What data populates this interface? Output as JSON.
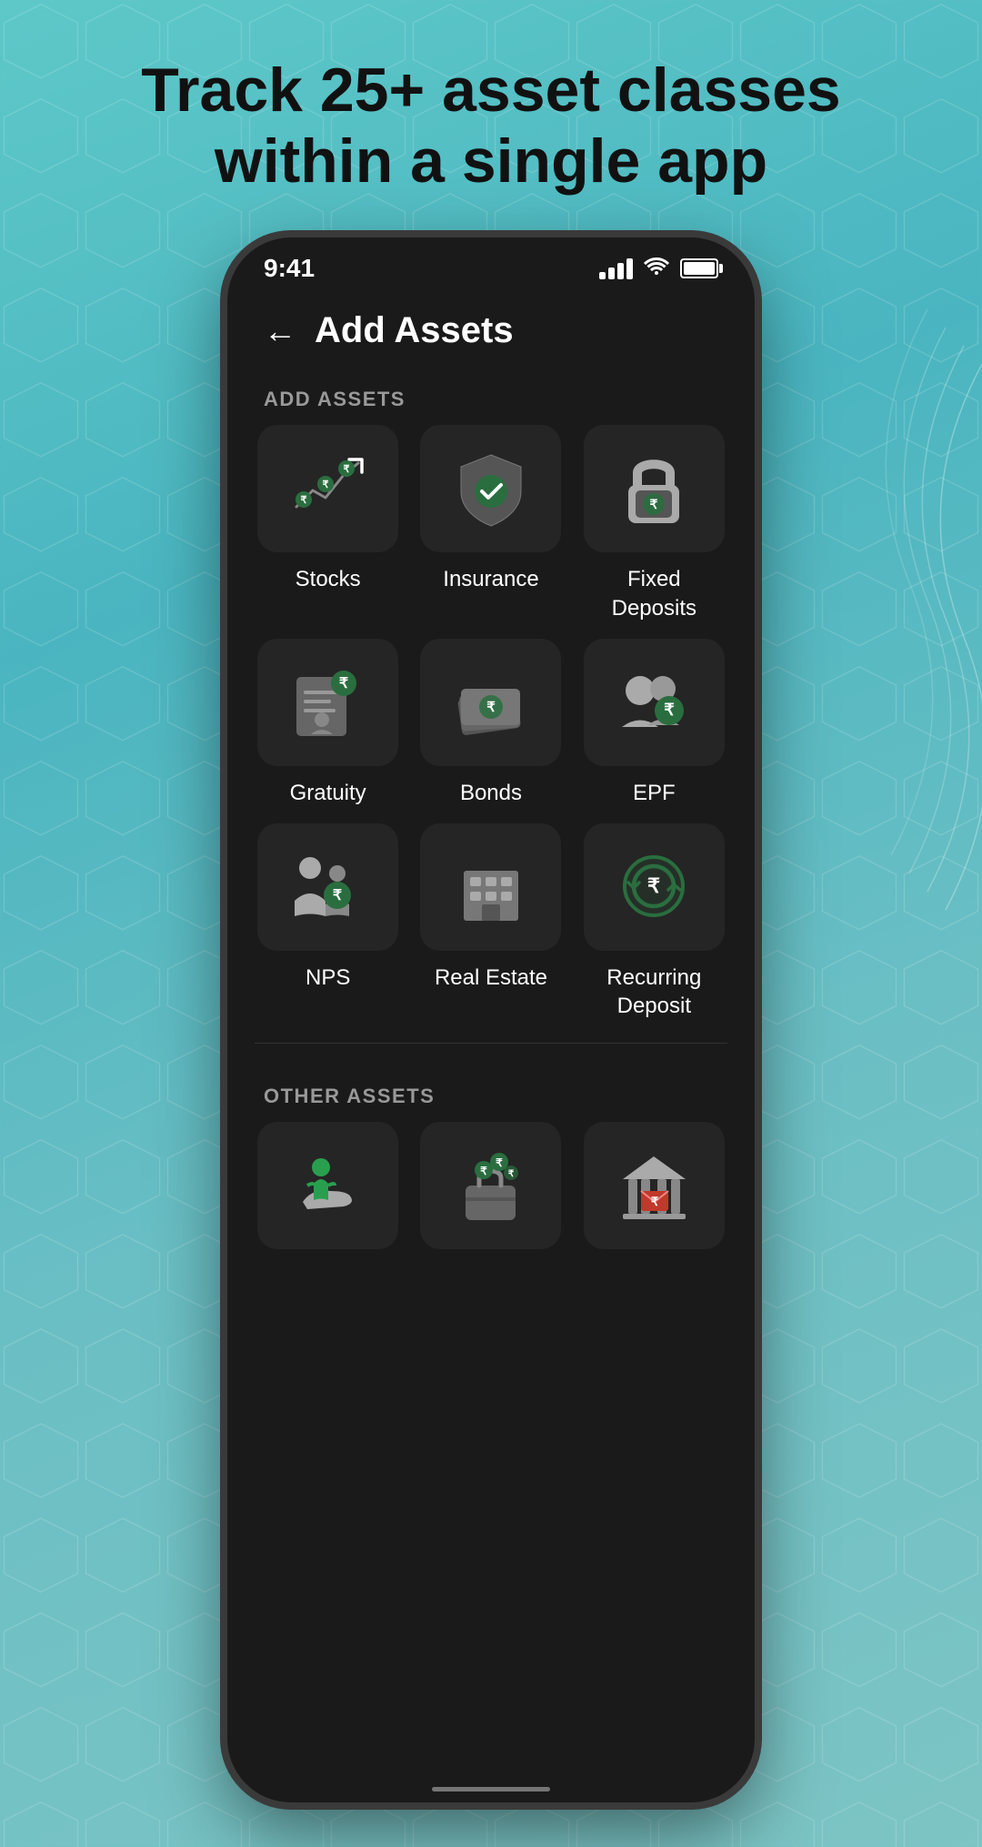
{
  "page": {
    "headline_line1": "Track 25+ asset classes",
    "headline_line2": "within a single app"
  },
  "status_bar": {
    "time": "9:41"
  },
  "header": {
    "back_label": "←",
    "title": "Add Assets"
  },
  "sections": [
    {
      "label": "ADD ASSETS",
      "items": [
        {
          "id": "stocks",
          "label": "Stocks"
        },
        {
          "id": "insurance",
          "label": "Insurance"
        },
        {
          "id": "fixed-deposits",
          "label": "Fixed\nDeposits"
        },
        {
          "id": "gratuity",
          "label": "Gratuity"
        },
        {
          "id": "bonds",
          "label": "Bonds"
        },
        {
          "id": "epf",
          "label": "EPF"
        },
        {
          "id": "nps",
          "label": "NPS"
        },
        {
          "id": "real-estate",
          "label": "Real Estate"
        },
        {
          "id": "recurring-deposit",
          "label": "Recurring\nDeposit"
        }
      ]
    },
    {
      "label": "OTHER ASSETS",
      "items": [
        {
          "id": "other-1",
          "label": ""
        },
        {
          "id": "other-2",
          "label": ""
        },
        {
          "id": "other-3",
          "label": ""
        }
      ]
    }
  ]
}
